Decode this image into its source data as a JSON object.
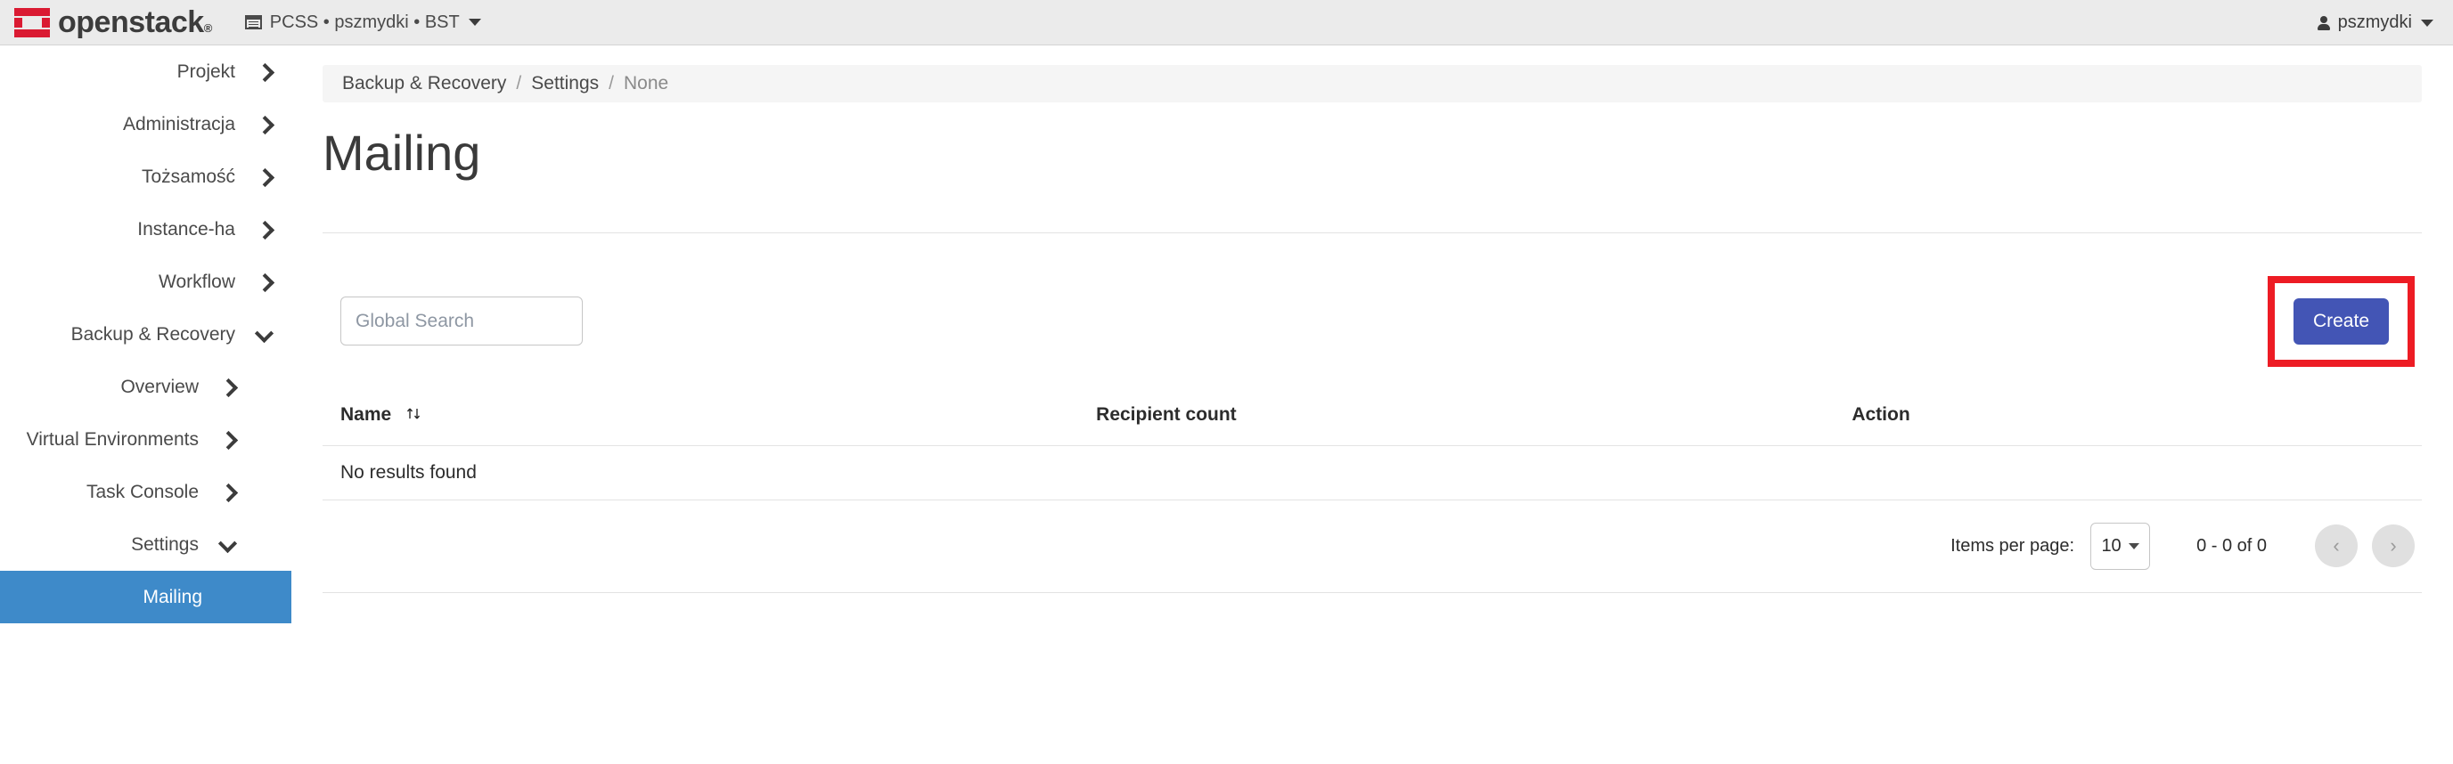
{
  "header": {
    "brand_name": "openstack",
    "brand_reg": "®",
    "context_label": "PCSS • pszmydki • BST",
    "user_label": "pszmydki"
  },
  "sidebar": {
    "items": [
      {
        "label": "Projekt",
        "level": 1,
        "state": "collapsed",
        "active": false
      },
      {
        "label": "Administracja",
        "level": 1,
        "state": "collapsed",
        "active": false
      },
      {
        "label": "Tożsamość",
        "level": 1,
        "state": "collapsed",
        "active": false
      },
      {
        "label": "Instance-ha",
        "level": 1,
        "state": "collapsed",
        "active": false
      },
      {
        "label": "Workflow",
        "level": 1,
        "state": "collapsed",
        "active": false
      },
      {
        "label": "Backup & Recovery",
        "level": 1,
        "state": "expanded",
        "active": false
      },
      {
        "label": "Overview",
        "level": 2,
        "state": "collapsed",
        "active": false
      },
      {
        "label": "Virtual Environments",
        "level": 2,
        "state": "collapsed",
        "active": false
      },
      {
        "label": "Task Console",
        "level": 2,
        "state": "collapsed",
        "active": false
      },
      {
        "label": "Settings",
        "level": 2,
        "state": "expanded",
        "active": false
      },
      {
        "label": "Mailing",
        "level": 3,
        "state": "none",
        "active": true
      }
    ]
  },
  "breadcrumb": {
    "items": [
      "Backup & Recovery",
      "Settings",
      "None"
    ],
    "separator": "/"
  },
  "page": {
    "title": "Mailing"
  },
  "toolbar": {
    "search_placeholder": "Global Search",
    "search_value": "",
    "create_label": "Create"
  },
  "table": {
    "columns": [
      {
        "label": "Name",
        "sortable": true
      },
      {
        "label": "Recipient count",
        "sortable": false
      },
      {
        "label": "Action",
        "sortable": false
      }
    ],
    "empty_message": "No results found",
    "rows": []
  },
  "paginator": {
    "items_per_page_label": "Items per page:",
    "items_per_page_value": "10",
    "range_label": "0 - 0 of 0",
    "prev_glyph": "‹",
    "next_glyph": "›"
  },
  "colors": {
    "brand_red": "#da1a32",
    "active_nav_blue": "#3e8ac9",
    "create_button_blue": "#4355b5",
    "annotation_red": "#ed1c24",
    "topbar_bg": "#ebebeb"
  },
  "annotation": {
    "type": "highlight-box",
    "target": "create-button"
  }
}
